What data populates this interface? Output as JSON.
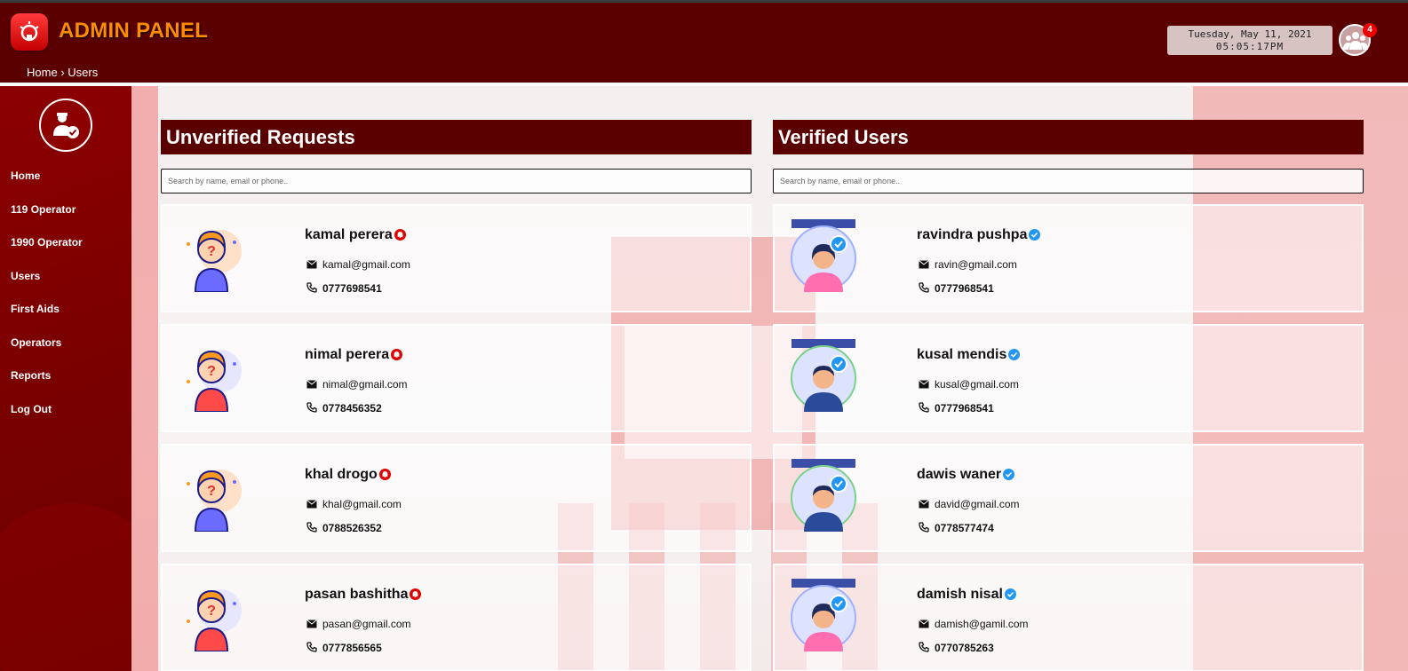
{
  "header": {
    "title": "ADMIN PANEL",
    "breadcrumb": {
      "home": "Home",
      "sep": "›",
      "current": "Users"
    },
    "date": "Tuesday, May 11, 2021",
    "time": "05:05:17PM",
    "notification_count": "4"
  },
  "sidebar": {
    "items": [
      {
        "label": "Home"
      },
      {
        "label": "119 Operator"
      },
      {
        "label": "1990 Operator"
      },
      {
        "label": "Users"
      },
      {
        "label": "First Aids"
      },
      {
        "label": "Operators"
      },
      {
        "label": "Reports"
      },
      {
        "label": "Log Out"
      }
    ]
  },
  "unverified": {
    "title": "Unverified Requests",
    "search_placeholder": "Search by name, email or phone..",
    "users": [
      {
        "name": "kamal perera",
        "email": "kamal@gmail.com",
        "phone": "0777698541"
      },
      {
        "name": "nimal perera",
        "email": "nimal@gmail.com",
        "phone": "0778456352"
      },
      {
        "name": "khal drogo",
        "email": "khal@gmail.com",
        "phone": "0788526352"
      },
      {
        "name": "pasan bashitha",
        "email": "pasan@gmail.com",
        "phone": "0777856565"
      }
    ]
  },
  "verified": {
    "title": "Verified Users",
    "search_placeholder": "Search by name, email or phone..",
    "users": [
      {
        "name": "ravindra pushpa",
        "email": "ravin@gmail.com",
        "phone": "0777968541"
      },
      {
        "name": "kusal mendis",
        "email": "kusal@gmail.com",
        "phone": "0777968541"
      },
      {
        "name": "dawis waner",
        "email": "david@gmail.com",
        "phone": "0778577474"
      },
      {
        "name": "damish nisal",
        "email": "damish@gamil.com",
        "phone": "0770785263"
      }
    ]
  },
  "colors": {
    "header_bg": "#5a0000",
    "sidebar_bg": "#8c0000",
    "title_accent": "#ff8c00",
    "unverified_icon": "#e00000",
    "verified_icon": "#2196f3"
  },
  "icons": {
    "logo": "alarm-siren-icon",
    "group": "users-group-icon",
    "admin": "user-check-icon",
    "email": "envelope-icon",
    "phone": "phone-icon",
    "unverified": "alert-bell-icon",
    "verified": "check-badge-icon"
  }
}
